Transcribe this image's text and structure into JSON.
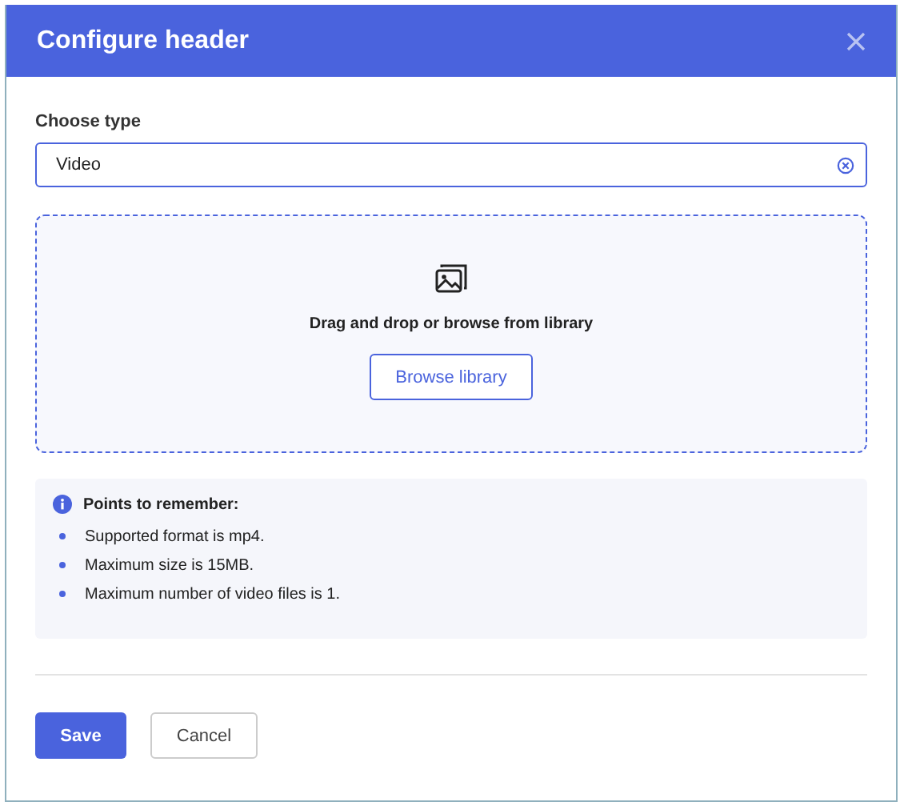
{
  "dialog": {
    "title": "Configure header"
  },
  "type_field": {
    "label": "Choose type",
    "value": "Video"
  },
  "dropzone": {
    "text": "Drag and drop or browse from library",
    "button": "Browse library"
  },
  "notes": {
    "title": "Points to remember:",
    "items": [
      "Supported format is mp4.",
      "Maximum size is 15MB.",
      "Maximum number of video files is 1."
    ]
  },
  "buttons": [
    {
      "label": "Save",
      "kind": "primary"
    },
    {
      "label": "Cancel",
      "kind": "secondary"
    }
  ]
}
